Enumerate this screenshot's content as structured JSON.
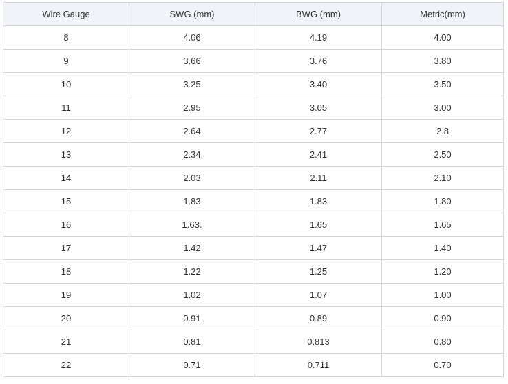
{
  "table": {
    "headers": [
      "Wire Gauge",
      "SWG (mm)",
      "BWG (mm)",
      "Metric(mm)"
    ],
    "rows": [
      [
        "8",
        "4.06",
        "4.19",
        "4.00"
      ],
      [
        "9",
        "3.66",
        "3.76",
        "3.80"
      ],
      [
        "10",
        "3.25",
        "3.40",
        "3.50"
      ],
      [
        "11",
        "2.95",
        "3.05",
        "3.00"
      ],
      [
        "12",
        "2.64",
        "2.77",
        "2.8"
      ],
      [
        "13",
        "2.34",
        "2.41",
        "2.50"
      ],
      [
        "14",
        "2.03",
        "2.11",
        "2.10"
      ],
      [
        "15",
        "1.83",
        "1.83",
        "1.80"
      ],
      [
        "16",
        "1.63.",
        "1.65",
        "1.65"
      ],
      [
        "17",
        "1.42",
        "1.47",
        "1.40"
      ],
      [
        "18",
        "1.22",
        "1.25",
        "1.20"
      ],
      [
        "19",
        "1.02",
        "1.07",
        "1.00"
      ],
      [
        "20",
        "0.91",
        "0.89",
        "0.90"
      ],
      [
        "21",
        "0.81",
        "0.813",
        "0.80"
      ],
      [
        "22",
        "0.71",
        "0.711",
        "0.70"
      ]
    ]
  }
}
